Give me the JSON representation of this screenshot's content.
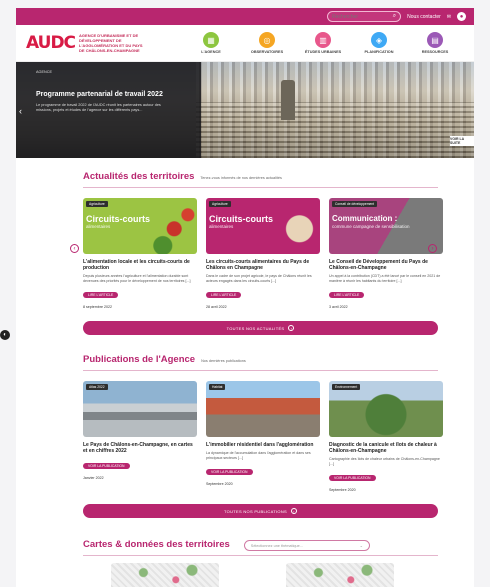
{
  "topbar": {
    "search_placeholder": "Rechercher",
    "contact_label": "Nous contacter"
  },
  "header": {
    "logo_mark": "AUDC",
    "logo_text": "AGENCE D'URBANISME ET DE DÉVELOPPEMENT DE L'AGGLOMÉRATION ET DU PAYS DE CHÂLONS-EN-CHAMPAGNE",
    "nav": [
      {
        "label": "L'AGENCE",
        "color": "#8dc63f",
        "icon": "building-icon"
      },
      {
        "label": "OBSERVATOIRES",
        "color": "#f5a623",
        "icon": "binoculars-icon"
      },
      {
        "label": "ÉTUDES URBAINES",
        "color": "#e8578b",
        "icon": "city-icon"
      },
      {
        "label": "PLANIFICATION",
        "color": "#3fa9f5",
        "icon": "map-icon"
      },
      {
        "label": "RESSOURCES",
        "color": "#9b59b6",
        "icon": "book-icon"
      }
    ]
  },
  "hero": {
    "tag": "AGENCE",
    "title": "Programme partenarial de travail 2022",
    "text": "Le programme de travail 2022 de l'AUDC réunit les partenaires autour des missions, projets et études de l'agence sur les différents pays...",
    "more_label": "VOIR LA SUITE"
  },
  "actualites": {
    "title": "Actualités des territoires",
    "subtitle": "Tenez-vous informés de nos dernières actualités",
    "cards": [
      {
        "tag": "Agriculture",
        "overlay": "Circuits-courts",
        "overlay_sub": "alimentaires",
        "img_color": "#9cc443",
        "title": "L'alimentation locale et les circuits-courts de production",
        "text": "Depuis plusieurs années l'agriculture et l'alimentation durable sont devenues des priorités pour le développement de nos territoires [...]",
        "button": "LIRE L'ARTICLE",
        "date": "8 septembre 2022"
      },
      {
        "tag": "Agriculture",
        "overlay": "Circuits-courts",
        "overlay_sub": "alimentaires",
        "img_color": "#b8266f",
        "title": "Les circuits-courts alimentaires du Pays de Châlons en Champagne",
        "text": "Dans le cadre de son projet agricole, le pays de Châlons réunit les acteurs engagés dans les circuits-courts [...]",
        "button": "LIRE L'ARTICLE",
        "date": "28 avril 2022"
      },
      {
        "tag": "Conseil de développement",
        "overlay": "Communication :",
        "overlay_sub": "commune campagne de sensibilisation",
        "img_color": "#a8447e",
        "title": "Le Conseil de Développement du Pays de Châlons-en-Champagne",
        "text": "Un appel à la contribution (CDT) a été lancé par le conseil en 2021 de manière à réunir les habitants du territoire [...]",
        "button": "LIRE L'ARTICLE",
        "date": "3 avril 2022"
      }
    ],
    "all_button": "TOUTES NOS ACTUALITÉS"
  },
  "publications": {
    "title": "Publications de l'Agence",
    "subtitle": "Nos dernières publications",
    "cards": [
      {
        "tag": "Atlas 2022",
        "title": "Le Pays de Châlons-en-Champagne, en cartes et en chiffres 2022",
        "text": "",
        "button": "VOIR LA PUBLICATION",
        "date": "Janvier 2022"
      },
      {
        "tag": "Habitat",
        "title": "L'immobilier résidentiel dans l'agglomération",
        "text": "La dynamique de l'accumulation dans l'agglomération et dans ses principaux secteurs [...]",
        "button": "VOIR LA PUBLICATION",
        "date": "Septembre 2020"
      },
      {
        "tag": "Environnement",
        "title": "Diagnostic de la canicule et îlots de chaleur à Châlons-en-Champagne",
        "text": "Cartographie des îlots de chaleur urbains de Châlons-en-Champagne [...]",
        "button": "VOIR LA PUBLICATION",
        "date": "Septembre 2020"
      }
    ],
    "all_button": "TOUTES NOS PUBLICATIONS"
  },
  "cartes": {
    "title": "Cartes & données des territoires",
    "select_placeholder": "Sélectionnez une thématique..."
  }
}
